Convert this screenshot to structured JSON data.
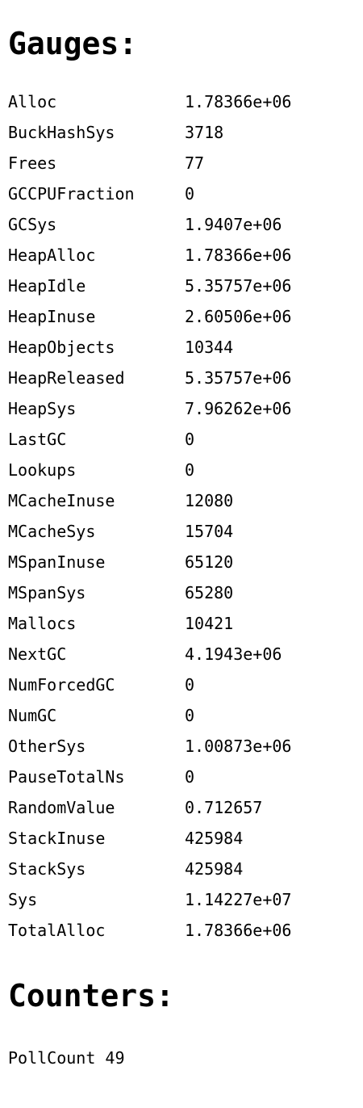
{
  "gauges": {
    "heading": "Gauges:",
    "rows": [
      {
        "name": "Alloc",
        "value": "1.78366e+06"
      },
      {
        "name": "BuckHashSys",
        "value": "3718"
      },
      {
        "name": "Frees",
        "value": "77"
      },
      {
        "name": "GCCPUFraction",
        "value": "0"
      },
      {
        "name": "GCSys",
        "value": "1.9407e+06"
      },
      {
        "name": "HeapAlloc",
        "value": "1.78366e+06"
      },
      {
        "name": "HeapIdle",
        "value": "5.35757e+06"
      },
      {
        "name": "HeapInuse",
        "value": "2.60506e+06"
      },
      {
        "name": "HeapObjects",
        "value": "10344"
      },
      {
        "name": "HeapReleased",
        "value": "5.35757e+06"
      },
      {
        "name": "HeapSys",
        "value": "7.96262e+06"
      },
      {
        "name": "LastGC",
        "value": "0"
      },
      {
        "name": "Lookups",
        "value": "0"
      },
      {
        "name": "MCacheInuse",
        "value": "12080"
      },
      {
        "name": "MCacheSys",
        "value": "15704"
      },
      {
        "name": "MSpanInuse",
        "value": "65120"
      },
      {
        "name": "MSpanSys",
        "value": "65280"
      },
      {
        "name": "Mallocs",
        "value": "10421"
      },
      {
        "name": "NextGC",
        "value": "4.1943e+06"
      },
      {
        "name": "NumForcedGC",
        "value": "0"
      },
      {
        "name": "NumGC",
        "value": "0"
      },
      {
        "name": "OtherSys",
        "value": "1.00873e+06"
      },
      {
        "name": "PauseTotalNs",
        "value": "0"
      },
      {
        "name": "RandomValue",
        "value": "0.712657"
      },
      {
        "name": "StackInuse",
        "value": "425984"
      },
      {
        "name": "StackSys",
        "value": "425984"
      },
      {
        "name": "Sys",
        "value": "1.14227e+07"
      },
      {
        "name": "TotalAlloc",
        "value": "1.78366e+06"
      }
    ]
  },
  "counters": {
    "heading": "Counters:",
    "rows": [
      {
        "name": "PollCount",
        "value": "49"
      }
    ]
  }
}
